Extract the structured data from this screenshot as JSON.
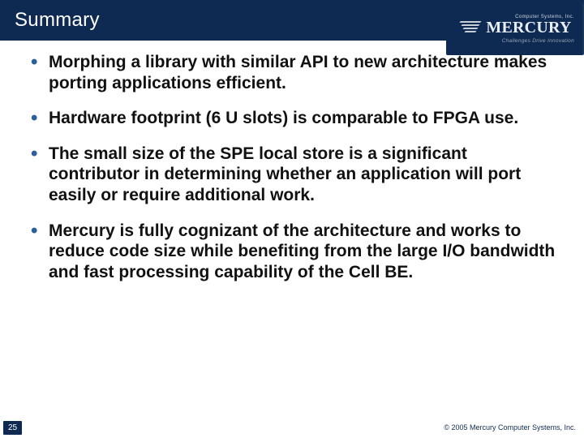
{
  "header": {
    "title": "Summary",
    "logo": {
      "top_text": "Computer Systems, Inc.",
      "name": "MERCURY",
      "tagline": "Challenges Drive Innovation"
    }
  },
  "bullets": [
    "Morphing a library with similar API to new architecture makes porting applications efficient.",
    "Hardware footprint (6 U slots) is comparable to FPGA use.",
    "The small size of the SPE local store is a significant contributor in determining whether an application will port easily or require additional work.",
    "Mercury is fully cognizant of the architecture and works to reduce code size while benefiting from the large I/O bandwidth and fast processing capability of the Cell BE."
  ],
  "footer": {
    "page": "25",
    "copyright": "© 2005 Mercury Computer Systems, Inc."
  },
  "colors": {
    "brand_navy": "#0e2a52",
    "bullet_blue": "#2c5f9b"
  }
}
